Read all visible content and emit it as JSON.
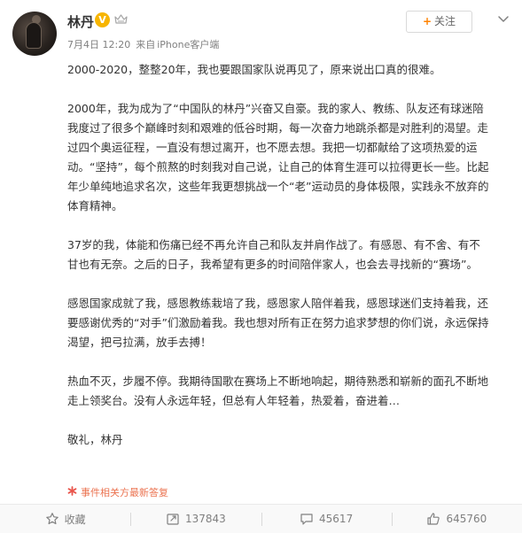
{
  "user": {
    "name": "林丹",
    "verified_badge": "V",
    "level_icon": "crown-icon"
  },
  "post": {
    "date": "7月4日 12:20",
    "source_prefix": "来自",
    "source_device": "iPhone客户端",
    "paragraphs": [
      "2000-2020，整整20年，我也要跟国家队说再见了，原来说出口真的很难。",
      "2000年，我为成为了“中国队的林丹”兴奋又自豪。我的家人、教练、队友还有球迷陪我度过了很多个巅峰时刻和艰难的低谷时期，每一次奋力地跳杀都是对胜利的渴望。走过四个奥运征程，一直没有想过离开，也不愿去想。我把一切都献给了这项热爱的运动。“坚持”，每个煎熬的时刻我对自己说，让自己的体育生涯可以拉得更长一些。比起年少单纯地追求名次，这些年我更想挑战一个“老”运动员的身体极限，实践永不放弃的体育精神。",
      "37岁的我，体能和伤痛已经不再允许自己和队友并肩作战了。有感恩、有不舍、有不甘也有无奈。之后的日子，我希望有更多的时间陪伴家人，也会去寻找新的“赛场”。",
      "感恩国家成就了我，感恩教练栽培了我，感恩家人陪伴着我，感恩球迷们支持着我，还要感谢优秀的“对手”们激励着我。我也想对所有正在努力追求梦想的你们说，永远保持渴望，把弓拉满，放手去搏！",
      "热血不灭，步履不停。我期待国歌在赛场上不断地响起，期待熟悉和崭新的面孔不断地走上领奖台。没有人永远年轻，但总有人年轻着，热爱着，奋进着…",
      "敬礼，林丹"
    ],
    "source_tag": "事件相关方最新答复"
  },
  "follow": {
    "plus": "+",
    "label": "关注"
  },
  "actions": {
    "favorite": "收藏",
    "repost_count": "137843",
    "comment_count": "45617",
    "like_count": "645760"
  },
  "colors": {
    "accent": "#ff8200",
    "tag": "#eb7350",
    "verified": "#f7b500"
  }
}
